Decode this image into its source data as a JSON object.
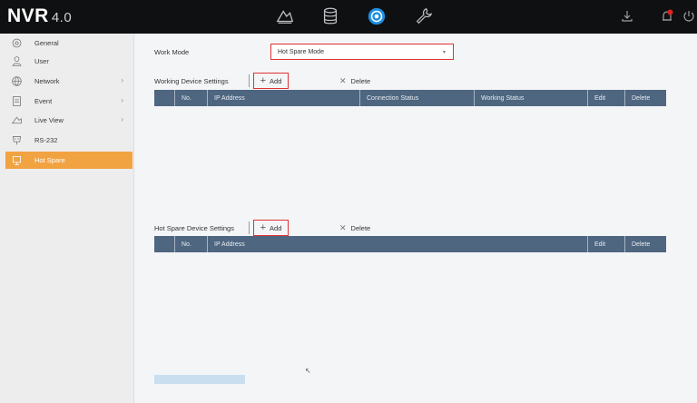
{
  "app": {
    "logo": "NVR",
    "version": "4.0"
  },
  "topbar": {
    "icons": [
      "playback-icon",
      "storage-icon",
      "settings-icon",
      "maintenance-icon",
      "download-icon",
      "alarm-icon",
      "power-icon"
    ],
    "accent": "#1e8fe0",
    "alarm_color": "#e02020"
  },
  "sidebar": {
    "items": [
      {
        "label": "General",
        "icon": "gear-icon",
        "has_submenu": false
      },
      {
        "label": "User",
        "icon": "user-icon",
        "has_submenu": false
      },
      {
        "label": "Network",
        "icon": "globe-icon",
        "has_submenu": true
      },
      {
        "label": "Event",
        "icon": "event-icon",
        "has_submenu": true
      },
      {
        "label": "Live View",
        "icon": "camera-icon",
        "has_submenu": true
      },
      {
        "label": "RS-232",
        "icon": "rs232-icon",
        "has_submenu": false
      },
      {
        "label": "Hot Spare",
        "icon": "hot-spare-icon",
        "has_submenu": false,
        "active": true
      }
    ],
    "active_color": "#f2a341"
  },
  "work_mode": {
    "label": "Work Mode",
    "value": "Hot Spare Mode"
  },
  "working_devices": {
    "title": "Working Device Settings",
    "add_label": "Add",
    "delete_label": "Delete",
    "columns": [
      "No.",
      "IP Address",
      "Connection Status",
      "Working Status",
      "Edit",
      "Delete"
    ],
    "rows": []
  },
  "hot_spare_devices": {
    "title": "Hot Spare Device Settings",
    "add_label": "Add",
    "delete_label": "Delete",
    "columns": [
      "No.",
      "IP Address",
      "Edit",
      "Delete"
    ],
    "rows": []
  },
  "table_header_color": "#4e6680",
  "highlight_color": "#e03232"
}
